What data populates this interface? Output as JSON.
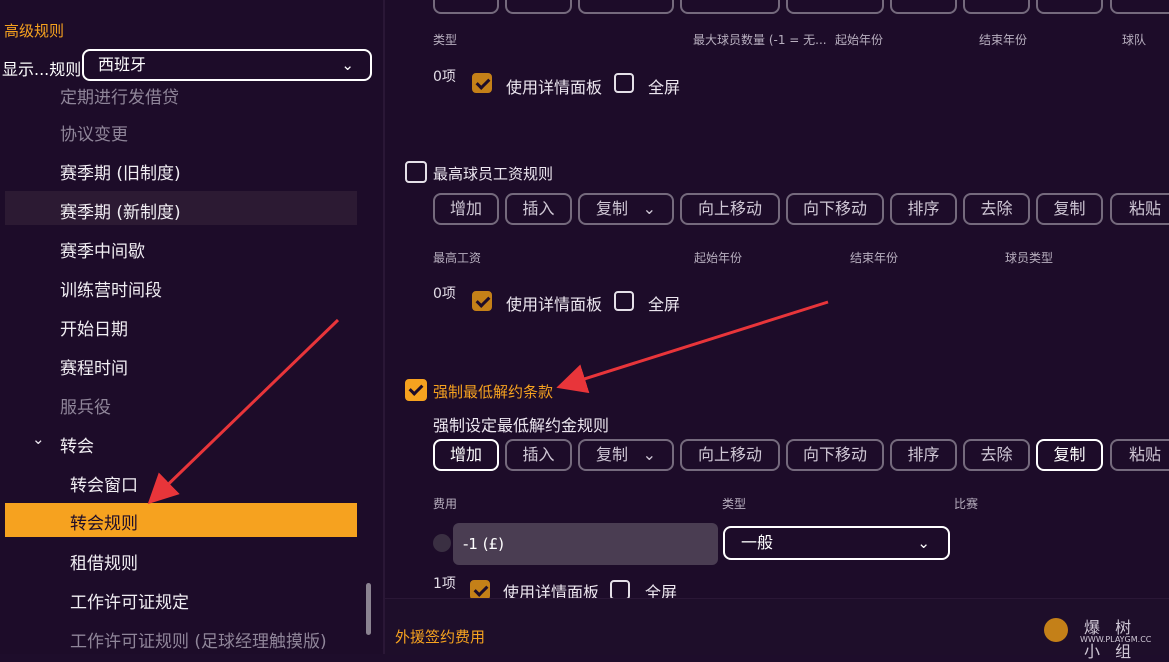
{
  "left": {
    "title": "高级规则",
    "show_label": "显示...规则",
    "country": "西班牙",
    "nav": [
      {
        "label": "定期进行发借贷",
        "dim": true
      },
      {
        "label": "协议变更",
        "dim": true
      },
      {
        "label": "赛季期 (旧制度)",
        "dim": false
      },
      {
        "label": "赛季期 (新制度)",
        "dim": false
      },
      {
        "label": "赛季中间歇",
        "dim": false
      },
      {
        "label": "训练营时间段",
        "dim": false
      },
      {
        "label": "开始日期",
        "dim": false
      },
      {
        "label": "赛程时间",
        "dim": false
      },
      {
        "label": "服兵役",
        "dim": true
      },
      {
        "label": "转会",
        "dim": false
      },
      {
        "label": "转会窗口",
        "dim": false
      },
      {
        "label": "转会规则",
        "dim": false
      },
      {
        "label": "租借规则",
        "dim": false
      },
      {
        "label": "工作许可证规定",
        "dim": false
      },
      {
        "label": "工作许可证规则 (足球经理触摸版)",
        "dim": true
      }
    ]
  },
  "toolbar_labels": {
    "add": "增加",
    "insert": "插入",
    "copy_dd": "复制",
    "move_up": "向上移动",
    "move_down": "向下移动",
    "sort": "排序",
    "remove": "去除",
    "copy": "复制",
    "paste": "粘贴"
  },
  "section1": {
    "columns": [
      "类型",
      "最大球员数量 (-1 = 无...",
      "起始年份",
      "结束年份",
      "球队"
    ],
    "count": "0项",
    "use_detail": "使用详情面板",
    "fullscreen": "全屏"
  },
  "section2": {
    "title": "最高球员工资规则",
    "columns": [
      "最高工资",
      "起始年份",
      "结束年份",
      "球员类型"
    ],
    "count": "0项",
    "use_detail": "使用详情面板",
    "fullscreen": "全屏"
  },
  "section3": {
    "title": "强制最低解约条款",
    "subtitle": "强制设定最低解约金规则",
    "columns": [
      "费用",
      "类型",
      "比赛"
    ],
    "fee_value": "-1 (£)",
    "type_value": "一般",
    "count": "1项",
    "use_detail": "使用详情面板",
    "fullscreen": "全屏"
  },
  "bottom": {
    "foreign_fee": "外援签约费用"
  },
  "watermark": {
    "text": "爆 树 小 组",
    "url": "WWW.PLAYGM.CC"
  },
  "colors": {
    "accent": "#f6a21f",
    "background": "#1d0c29",
    "arrow": "#e8353a"
  }
}
